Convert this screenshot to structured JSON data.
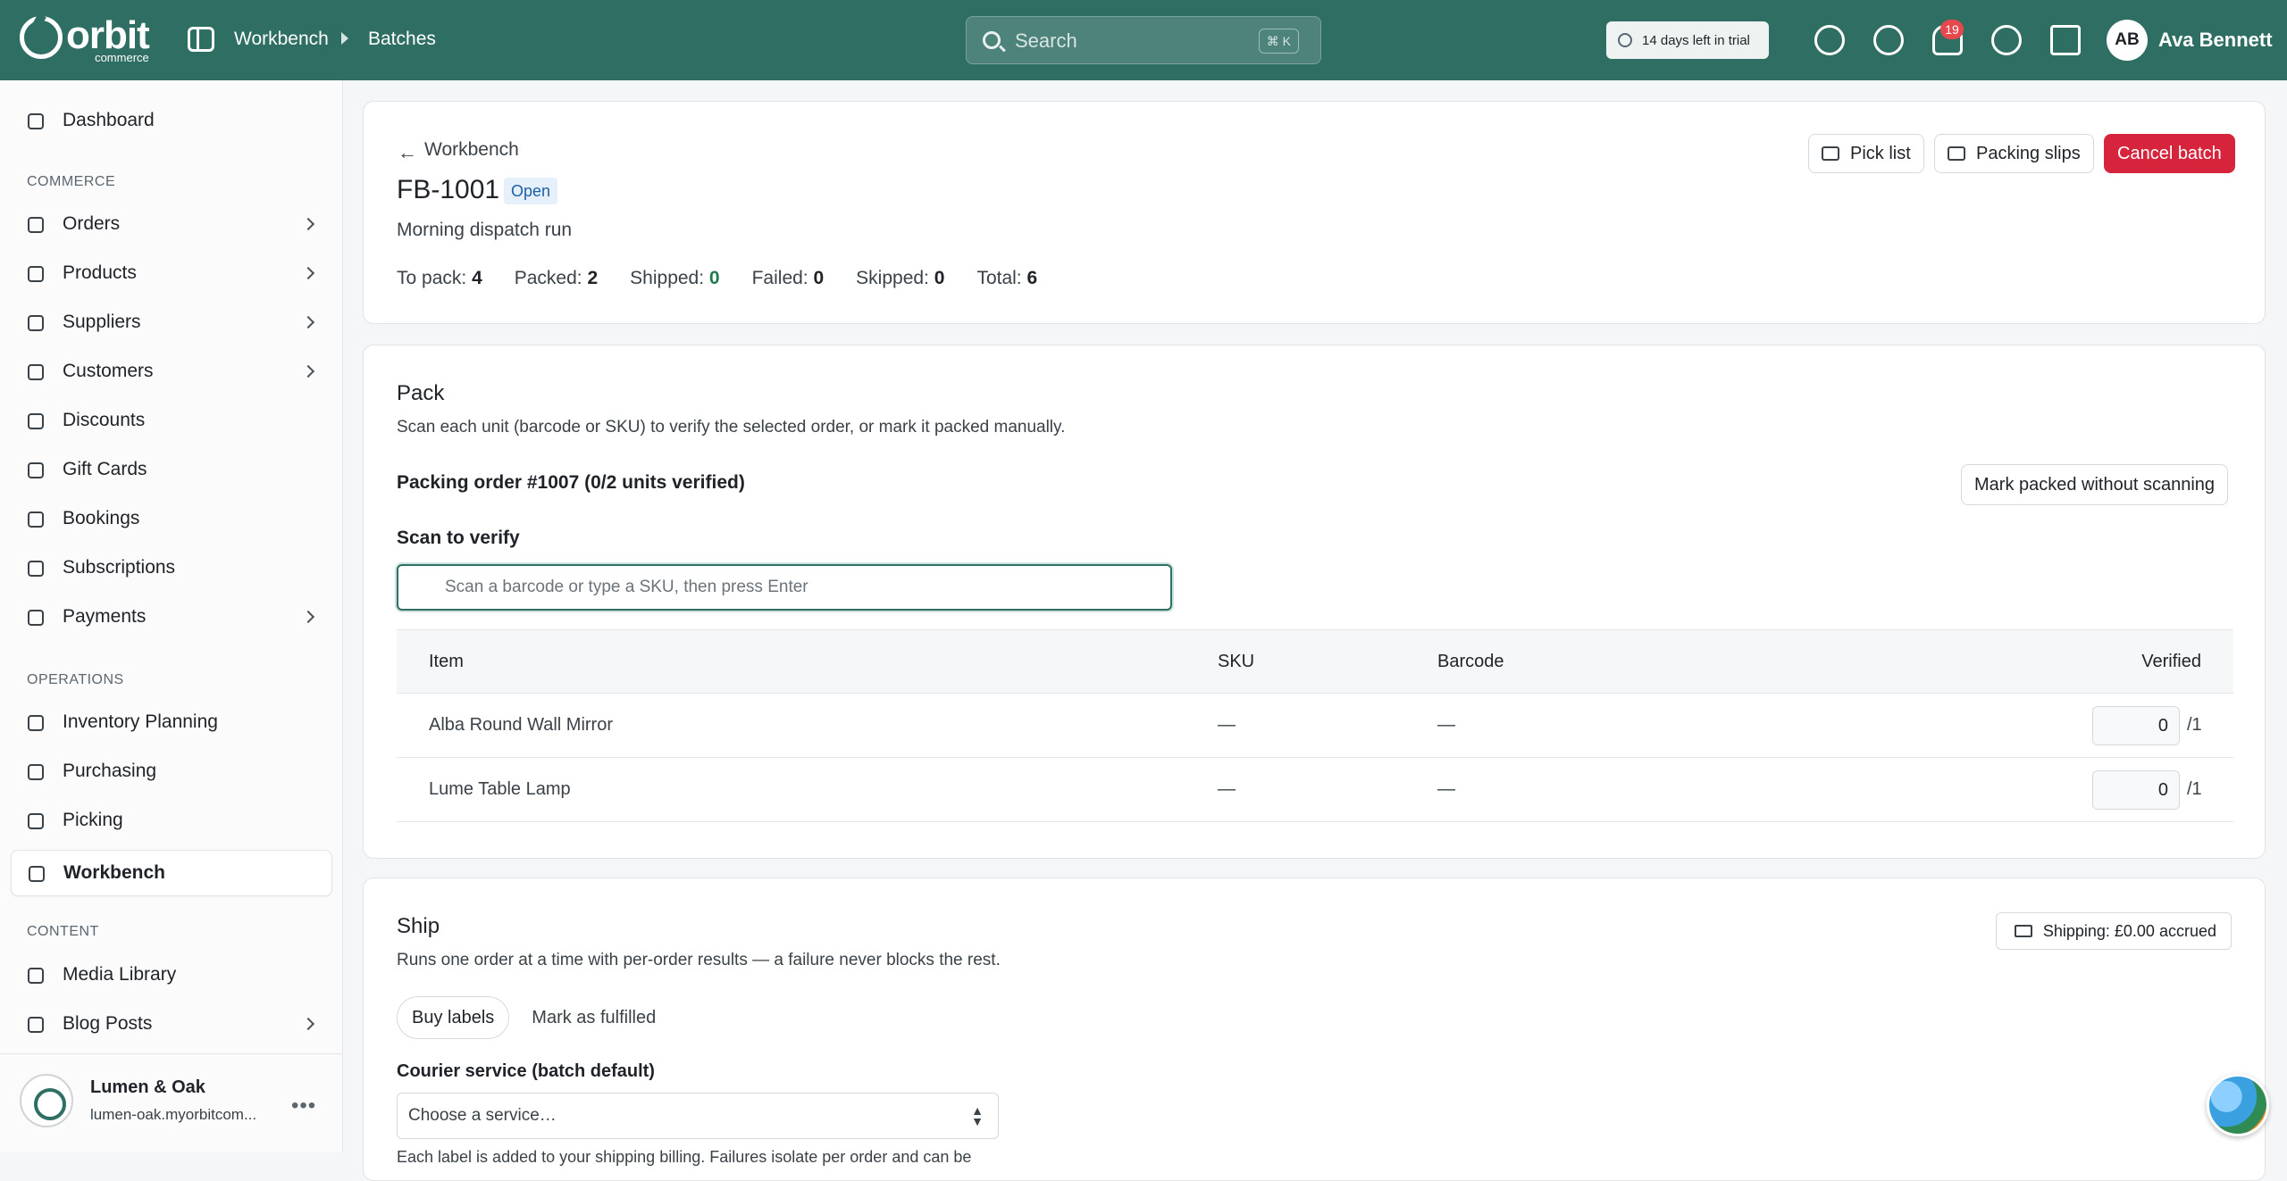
{
  "brand": {
    "logo_word": "orbit",
    "logo_sub": "commerce"
  },
  "breadcrumb": [
    "Workbench",
    "Batches"
  ],
  "search": {
    "placeholder": "Search",
    "shortcut": "⌘ K"
  },
  "trial": {
    "label": "14 days left in trial"
  },
  "notifications": {
    "count": "19"
  },
  "user": {
    "initials": "AB",
    "name": "Ava Bennett"
  },
  "sidebar": {
    "top": [
      {
        "label": "Dashboard",
        "icon": "dashboard-icon"
      }
    ],
    "sections": [
      {
        "title": "COMMERCE",
        "items": [
          {
            "label": "Orders",
            "icon": "orders-icon",
            "chevron": true
          },
          {
            "label": "Products",
            "icon": "products-icon",
            "chevron": true
          },
          {
            "label": "Suppliers",
            "icon": "suppliers-icon",
            "chevron": true
          },
          {
            "label": "Customers",
            "icon": "customers-icon",
            "chevron": true
          },
          {
            "label": "Discounts",
            "icon": "discounts-icon",
            "chevron": false
          },
          {
            "label": "Gift Cards",
            "icon": "gift-icon",
            "chevron": false
          },
          {
            "label": "Bookings",
            "icon": "calendar-icon",
            "chevron": false
          },
          {
            "label": "Subscriptions",
            "icon": "refresh-icon",
            "chevron": false
          },
          {
            "label": "Payments",
            "icon": "payments-icon",
            "chevron": true
          }
        ]
      },
      {
        "title": "OPERATIONS",
        "items": [
          {
            "label": "Inventory Planning",
            "icon": "clipboard-icon",
            "chevron": false
          },
          {
            "label": "Purchasing",
            "icon": "purchasing-icon",
            "chevron": false
          },
          {
            "label": "Picking",
            "icon": "pin-icon",
            "chevron": false
          },
          {
            "label": "Workbench",
            "icon": "box-icon",
            "chevron": false,
            "active": true
          }
        ]
      },
      {
        "title": "CONTENT",
        "items": [
          {
            "label": "Media Library",
            "icon": "image-icon",
            "chevron": false
          },
          {
            "label": "Blog Posts",
            "icon": "blog-icon",
            "chevron": true
          }
        ]
      }
    ],
    "store": {
      "name": "Lumen & Oak",
      "domain": "lumen-oak.myorbitcom..."
    }
  },
  "batch": {
    "back_label": "Workbench",
    "id": "FB-1001",
    "status": "Open",
    "description": "Morning dispatch run",
    "stats": [
      {
        "label": "To pack:",
        "value": "4"
      },
      {
        "label": "Packed:",
        "value": "2"
      },
      {
        "label": "Shipped:",
        "value": "0"
      },
      {
        "label": "Failed:",
        "value": "0"
      },
      {
        "label": "Skipped:",
        "value": "0"
      },
      {
        "label": "Total:",
        "value": "6"
      }
    ],
    "actions": {
      "pick_list": "Pick list",
      "packing_slips": "Packing slips",
      "cancel": "Cancel batch"
    }
  },
  "pack": {
    "title": "Pack",
    "subtitle": "Scan each unit (barcode or SKU) to verify the selected order, or mark it packed manually.",
    "order_label": "Packing order #1007 (0/2 units verified)",
    "mark_packed": "Mark packed without scanning",
    "scan_label": "Scan to verify",
    "scan_placeholder": "Scan a barcode or type a SKU, then press Enter",
    "columns": [
      "Item",
      "SKU",
      "Barcode",
      "Verified"
    ],
    "rows": [
      {
        "item": "Alba Round Wall Mirror",
        "sku": "—",
        "barcode": "—",
        "verified": "0",
        "of": "/1"
      },
      {
        "item": "Lume Table Lamp",
        "sku": "—",
        "barcode": "—",
        "verified": "0",
        "of": "/1"
      }
    ]
  },
  "ship": {
    "title": "Ship",
    "subtitle": "Runs one order at a time with per-order results — a failure never blocks the rest.",
    "shipping_badge": "Shipping: £0.00 accrued",
    "tabs": [
      "Buy labels",
      "Mark as fulfilled"
    ],
    "courier_label": "Courier service (batch default)",
    "courier_placeholder": "Choose a service…",
    "note": "Each label is added to your shipping billing. Failures isolate per order and can be"
  },
  "colors": {
    "topbar": "#2f6e62",
    "danger": "#d5243c",
    "status_blue": "#1d5fa6",
    "green": "#1f7a4d"
  }
}
